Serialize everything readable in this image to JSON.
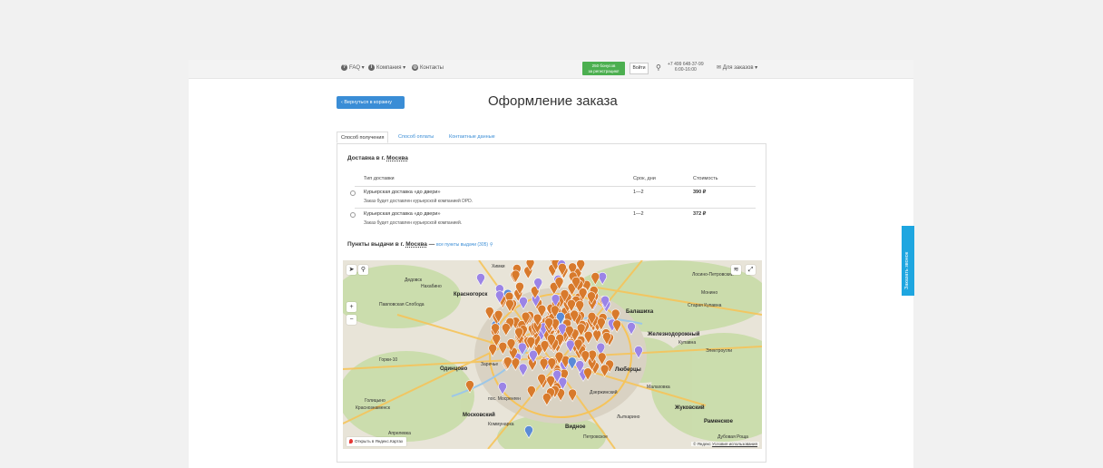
{
  "topbar": {
    "faq": "FAQ",
    "company": "Компания",
    "contacts": "Контакты",
    "bonus_line1": "250 бонусов",
    "bonus_line2": "за регистрацию!",
    "login": "Войти",
    "phone": "+7 499 648-37-99",
    "hours": "6:00-16:00",
    "orders": "Для заказов"
  },
  "back_button": "Вернуться в корзину",
  "page_title": "Оформление заказа",
  "tabs": [
    {
      "label": "Способ получения",
      "active": true
    },
    {
      "label": "Способ оплаты",
      "active": false
    },
    {
      "label": "Контактные данные",
      "active": false
    }
  ],
  "delivery": {
    "title_prefix": "Доставка в г.",
    "city": "Москва",
    "columns": [
      "Тип доставки",
      "Срок, дни",
      "Стоимость"
    ],
    "rows": [
      {
        "name": "Курьерская доставка «до двери»",
        "desc": "Заказ будет доставлен курьерской компанией DPD.",
        "days": "1—2",
        "cost": "390 ₽"
      },
      {
        "name": "Курьерская доставка «до двери»",
        "desc": "Заказ будет доставлен курьерской компанией.",
        "days": "1—2",
        "cost": "372 ₽"
      }
    ]
  },
  "pickup": {
    "title_prefix": "Пункты выдачи в г.",
    "city": "Москва",
    "dash": "—",
    "link": "все пункты выдачи (305)"
  },
  "map": {
    "open_link": "Открыть в Яндекс.Картах",
    "copyright": "© Яндекс",
    "terms": "Условия использования",
    "labels": [
      "Химки",
      "Лосино-Петровский",
      "Дедовск",
      "Нахабино",
      "Красногорск",
      "Мытищи",
      "Монино",
      "Старая Купавна",
      "Павловская Слобода",
      "Балашиха",
      "Железнодорожный",
      "Купавна",
      "Электроугли",
      "Одинцово",
      "Люберцы",
      "Дзержинский",
      "Малаховка",
      "Московский",
      "Коммунарка",
      "Видное",
      "Лыткарино",
      "Жуковский",
      "Раменское",
      "Голицыно",
      "Краснознаменск",
      "Апрелевка",
      "Петровское",
      "Дубовая Роща",
      "Горки-10",
      "Заречье",
      "пос. Мосренген"
    ],
    "colors": {
      "pickup": "#d87a2c",
      "postamat": "#9b84e6",
      "other": "#5b8bd6"
    }
  },
  "call_button": "Заказать звонок"
}
